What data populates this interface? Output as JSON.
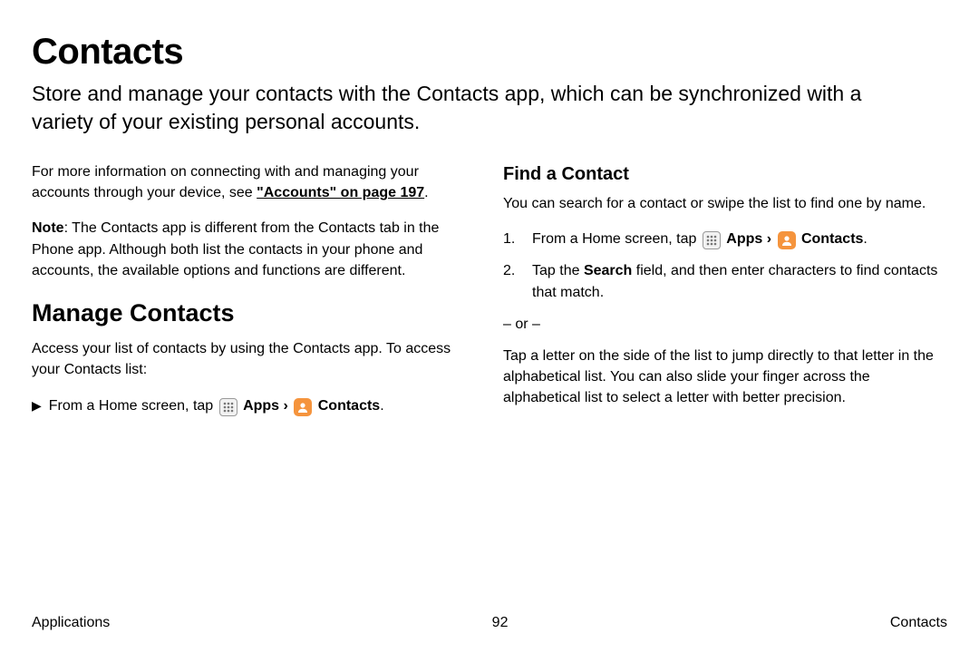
{
  "title": "Contacts",
  "intro": "Store and manage your contacts with the Contacts app, which can be synchronized with a variety of your existing personal accounts.",
  "left": {
    "info_para_pre": "For more information on connecting with and managing your accounts through your device, see ",
    "info_link": "\"Accounts\" on page 197",
    "info_para_post": ".",
    "note_label": "Note",
    "note_text": ": The Contacts app is different from the Contacts tab in the Phone app. Although both list the contacts in your phone and accounts, the available options and functions are different.",
    "manage_heading": "Manage Contacts",
    "manage_text": "Access your list of contacts by using the Contacts app. To access your Contacts list:",
    "from_home_prefix": "From a Home screen, tap ",
    "apps_label": "Apps",
    "separator": " › ",
    "contacts_label": "Contacts",
    "period": "."
  },
  "right": {
    "find_heading": "Find a Contact",
    "find_text": "You can search for a contact or swipe the list to find one by name.",
    "step1_prefix": "From a Home screen, tap ",
    "apps_label": "Apps",
    "separator": " › ",
    "contacts_label": "Contacts",
    "period": ".",
    "step2_pre": "Tap the ",
    "step2_bold": "Search",
    "step2_post": " field, and then enter characters to find contacts that match.",
    "or": "– or –",
    "alt_para": "Tap a letter on the side of the list to jump directly to that letter in the alphabetical list. You can also slide your finger across the alphabetical list to select a letter with better precision."
  },
  "footer": {
    "left": "Applications",
    "center": "92",
    "right": "Contacts"
  },
  "numbers": {
    "one": "1.",
    "two": "2."
  }
}
